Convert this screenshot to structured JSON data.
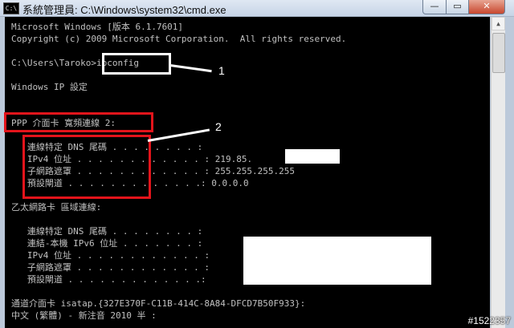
{
  "window": {
    "title": "系統管理員: C:\\Windows\\system32\\cmd.exe",
    "icon_label": "C:\\",
    "controls": {
      "minimize": "—",
      "maximize": "▭",
      "close": "✕"
    }
  },
  "console": {
    "lines": [
      "Microsoft Windows [版本 6.1.7601]",
      "Copyright (c) 2009 Microsoft Corporation.  All rights reserved.",
      "",
      "C:\\Users\\Taroko>ipconfig",
      "",
      "Windows IP 設定",
      "",
      "",
      "PPP 介面卡 寬頻連線 2:",
      "",
      "   連線特定 DNS 尾碼 . . . . . . . . :",
      "   IPv4 位址 . . . . . . . . . . . . : 219.85.",
      "   子網路遮罩 . . . . . . . . . . . . : 255.255.255.255",
      "   預設閘道 . . . . . . . . . . . . .: 0.0.0.0",
      "",
      "乙太網路卡 區域連線:",
      "",
      "   連線特定 DNS 尾碼 . . . . . . . . :",
      "   連結-本機 IPv6 位址 . . . . . . . :",
      "   IPv4 位址 . . . . . . . . . . . . :",
      "   子網路遮罩 . . . . . . . . . . . . :",
      "   預設閘道 . . . . . . . . . . . . .:",
      "",
      "通道介面卡 isatap.{327E370F-C11B-414C-8A84-DFCD7B50F933}:",
      "中文 (繁體) - 新注音 2010 半 :"
    ]
  },
  "annotations": {
    "label1": "1",
    "label2": "2"
  },
  "watermark": "#1522357",
  "colors": {
    "annotation_red": "#e3141b",
    "console_bg": "#000000",
    "console_text": "#c0c0c0"
  }
}
